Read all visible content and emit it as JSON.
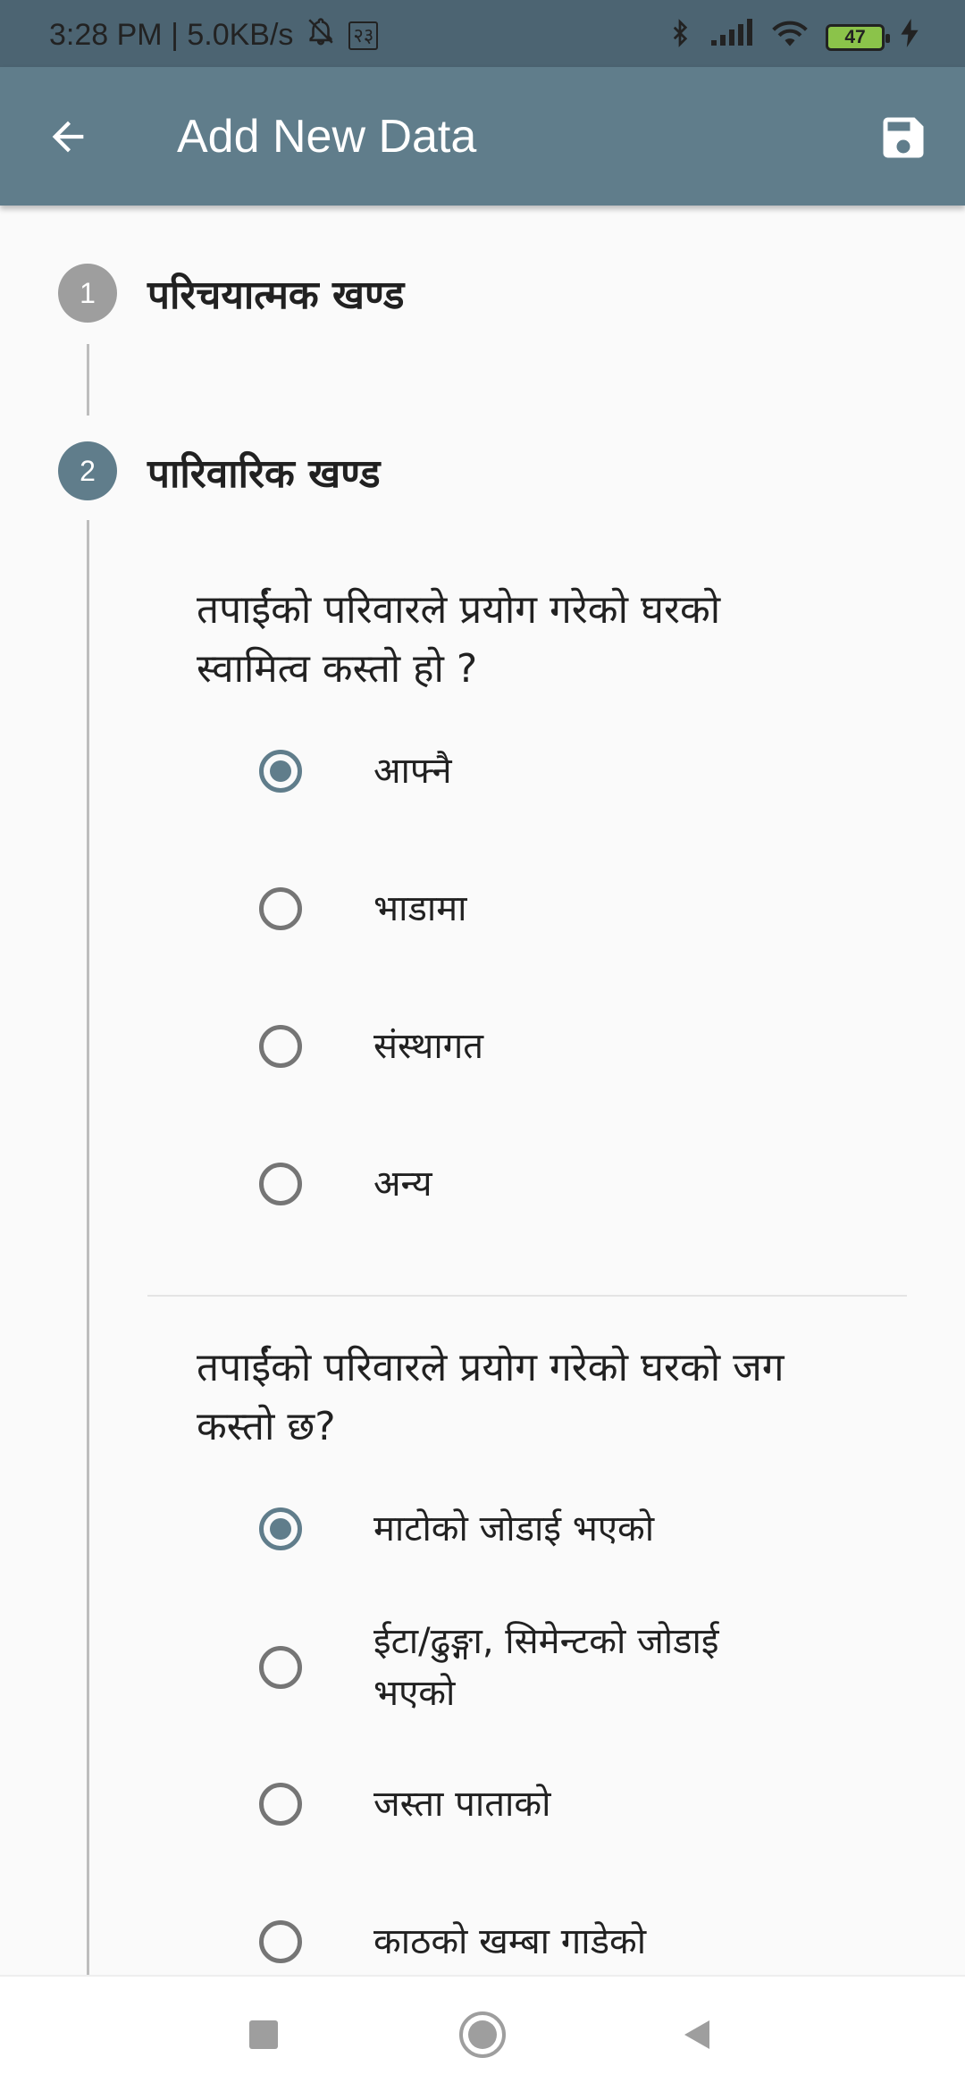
{
  "status_bar": {
    "time_speed": "3:28 PM | 5.0KB/s",
    "badge": "२३",
    "battery": "47"
  },
  "app_bar": {
    "title": "Add New Data"
  },
  "steps": [
    {
      "number": "1",
      "title": "परिचयात्मक खण्ड",
      "color": "#9e9e9e"
    },
    {
      "number": "2",
      "title": "पारिवारिक खण्ड",
      "color": "#607d8b"
    }
  ],
  "questions": [
    {
      "text_line1": "तपाईंको परिवारले प्रयोग गरेको घरको",
      "text_line2": "स्वामित्व कस्तो हो ?",
      "options": [
        {
          "label": "आफ्नै",
          "checked": true
        },
        {
          "label": "भाडामा",
          "checked": false
        },
        {
          "label": "संस्थागत",
          "checked": false
        },
        {
          "label": "अन्य",
          "checked": false
        }
      ]
    },
    {
      "text_line1": "तपाईंको परिवारले प्रयोग गरेको घरको जग",
      "text_line2": "कस्तो छ?",
      "options": [
        {
          "label": "माटोको जोडाई भएको",
          "checked": true
        },
        {
          "label": "ईटा/ढुङ्गा, सिमेन्टको जोडाई",
          "label2": "भएको",
          "checked": false
        },
        {
          "label": "जस्ता पाताको",
          "checked": false
        },
        {
          "label": "काठको खम्बा गाडेको",
          "checked": false
        }
      ]
    }
  ],
  "colors": {
    "app_bar": "#607d8b",
    "status_bar": "#4c6472",
    "accent": "#607d8b"
  }
}
